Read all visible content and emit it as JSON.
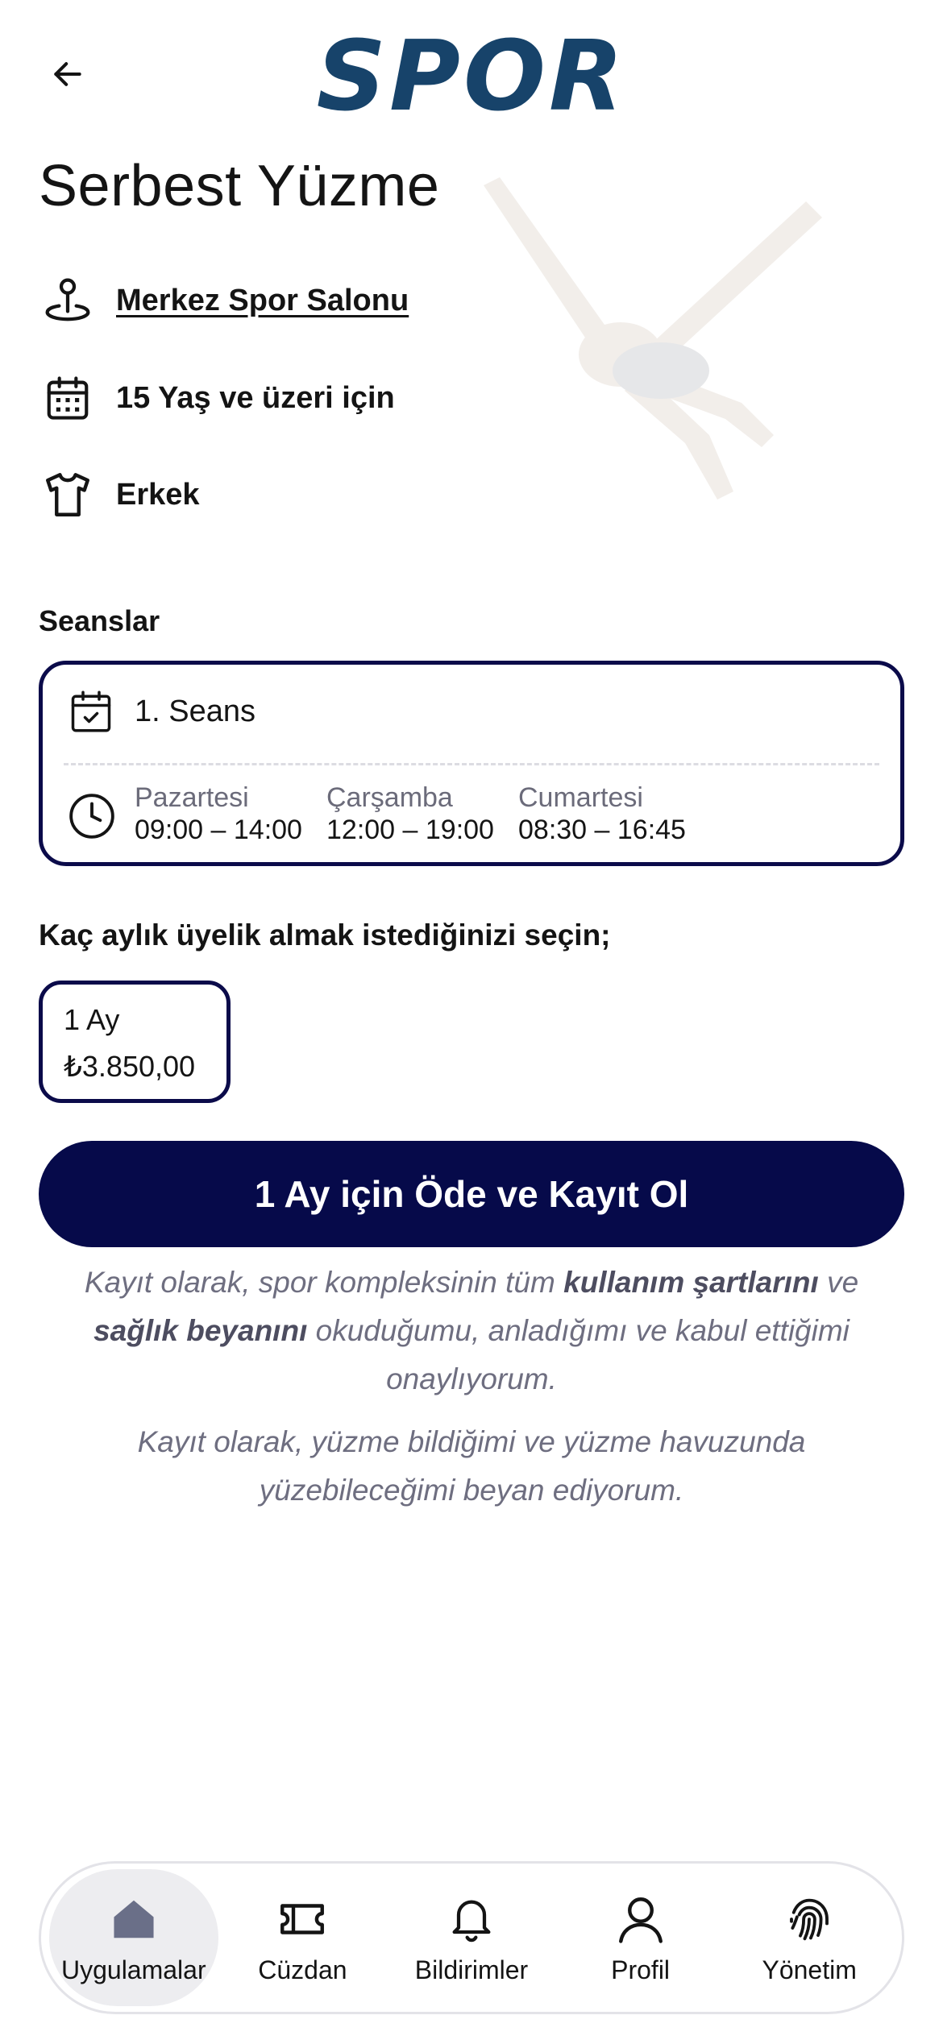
{
  "header": {
    "back_icon": "arrow-left-icon",
    "logo_text": "SPOR"
  },
  "activity": {
    "title": "Serbest Yüzme",
    "location": "Merkez Spor Salonu",
    "age": "15 Yaş ve üzeri için",
    "gender": "Erkek"
  },
  "sessions": {
    "label": "Seanslar",
    "items": [
      {
        "name": "1. Seans",
        "slots": [
          {
            "day": "Pazartesi",
            "hours": "09:00 – 14:00"
          },
          {
            "day": "Çarşamba",
            "hours": "12:00 – 19:00"
          },
          {
            "day": "Cumartesi",
            "hours": "08:30 – 16:45"
          }
        ]
      }
    ]
  },
  "membership": {
    "label": "Kaç aylık üyelik almak istediğinizi seçin;",
    "options": [
      {
        "duration": "1 Ay",
        "price": "₺3.850,00",
        "selected": true
      }
    ]
  },
  "cta": {
    "label": "1 Ay için Öde ve Kayıt Ol"
  },
  "terms": {
    "p1_a": "Kayıt olarak, spor kompleksinin tüm ",
    "p1_b": "kullanım şartlarını",
    "p1_c": " ve ",
    "p1_d": "sağlık beyanını",
    "p1_e": " okuduğumu, anladığımı ve kabul ettiğimi onaylıyorum.",
    "p2": "Kayıt olarak, yüzme bildiğimi ve yüzme havuzunda yüzebileceğimi beyan ediyorum."
  },
  "nav": {
    "items": [
      {
        "label": "Uygulamalar",
        "icon": "home-icon",
        "active": true
      },
      {
        "label": "Cüzdan",
        "icon": "ticket-icon",
        "active": false
      },
      {
        "label": "Bildirimler",
        "icon": "bell-icon",
        "active": false
      },
      {
        "label": "Profil",
        "icon": "user-icon",
        "active": false
      },
      {
        "label": "Yönetim",
        "icon": "fingerprint-icon",
        "active": false
      }
    ]
  },
  "colors": {
    "primary": "#060a4a",
    "logo": "#17436a",
    "muted_text": "#6e6e80"
  }
}
